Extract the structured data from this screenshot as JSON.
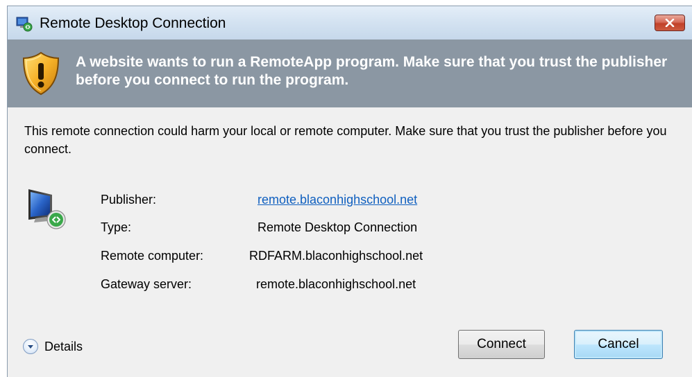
{
  "window": {
    "title": "Remote Desktop Connection",
    "close_glyph": "✕"
  },
  "banner": {
    "message": "A website wants to run a RemoteApp program. Make sure that you trust the publisher before you connect to run the program.",
    "icon": "shield-warning-icon"
  },
  "body": {
    "message": "This remote connection could harm your local or remote computer. Make sure that you trust the publisher before you connect."
  },
  "info": {
    "icon": "remote-computer-icon",
    "publisher_label": "Publisher:",
    "publisher_value": "remote.blaconhighschool.net",
    "type_label": "Type:",
    "type_value": "Remote Desktop Connection",
    "remote_label": "Remote computer:",
    "remote_value": "RDFARM.blaconhighschool.net",
    "gateway_label": "Gateway server:",
    "gateway_value": "remote.blaconhighschool.net"
  },
  "footer": {
    "details_label": "Details",
    "connect_label": "Connect",
    "cancel_label": "Cancel"
  },
  "colors": {
    "banner_bg": "#8b97a3",
    "link": "#0f5fbf",
    "close_button": "#c14129"
  }
}
